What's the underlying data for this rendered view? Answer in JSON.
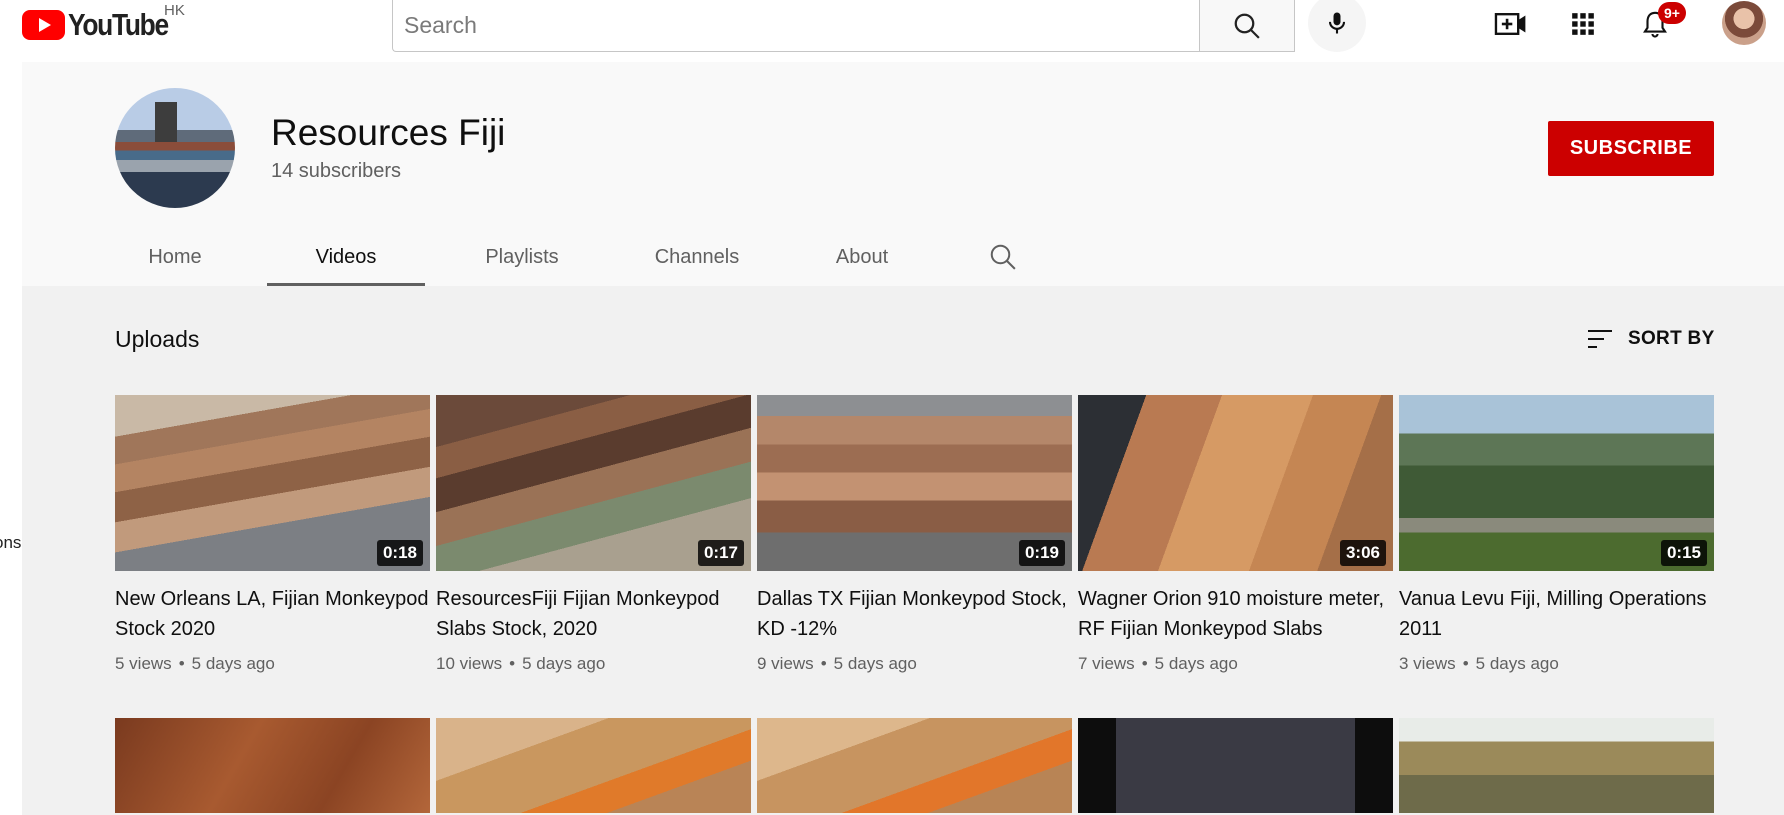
{
  "masthead": {
    "logo_text": "YouTube",
    "region": "HK",
    "search_placeholder": "Search",
    "notification_count": "9+"
  },
  "sidebar": {
    "partial_label": "ons"
  },
  "channel": {
    "name": "Resources Fiji",
    "subscribers": "14 subscribers",
    "subscribe_label": "SUBSCRIBE"
  },
  "tabs": [
    {
      "label": "Home"
    },
    {
      "label": "Videos"
    },
    {
      "label": "Playlists"
    },
    {
      "label": "Channels"
    },
    {
      "label": "About"
    }
  ],
  "uploads": {
    "title": "Uploads",
    "sort_label": "SORT BY"
  },
  "videos": [
    {
      "title": "New Orleans LA, Fijian Monkeypod Stock 2020",
      "duration": "0:18",
      "views": "5 views",
      "age": "5 days ago"
    },
    {
      "title": "ResourcesFiji Fijian Monkeypod Slabs Stock, 2020",
      "duration": "0:17",
      "views": "10 views",
      "age": "5 days ago"
    },
    {
      "title": "Dallas TX Fijian Monkeypod Stock, KD -12%",
      "duration": "0:19",
      "views": "9 views",
      "age": "5 days ago"
    },
    {
      "title": "Wagner Orion 910 moisture meter, RF Fijian Monkeypod Slabs",
      "duration": "3:06",
      "views": "7 views",
      "age": "5 days ago"
    },
    {
      "title": "Vanua Levu Fiji, Milling Operations 2011",
      "duration": "0:15",
      "views": "3 views",
      "age": "5 days ago"
    }
  ],
  "colors": {
    "brand_red": "#ff0000",
    "subscribe_red": "#cc0000",
    "text_secondary": "#606060"
  }
}
